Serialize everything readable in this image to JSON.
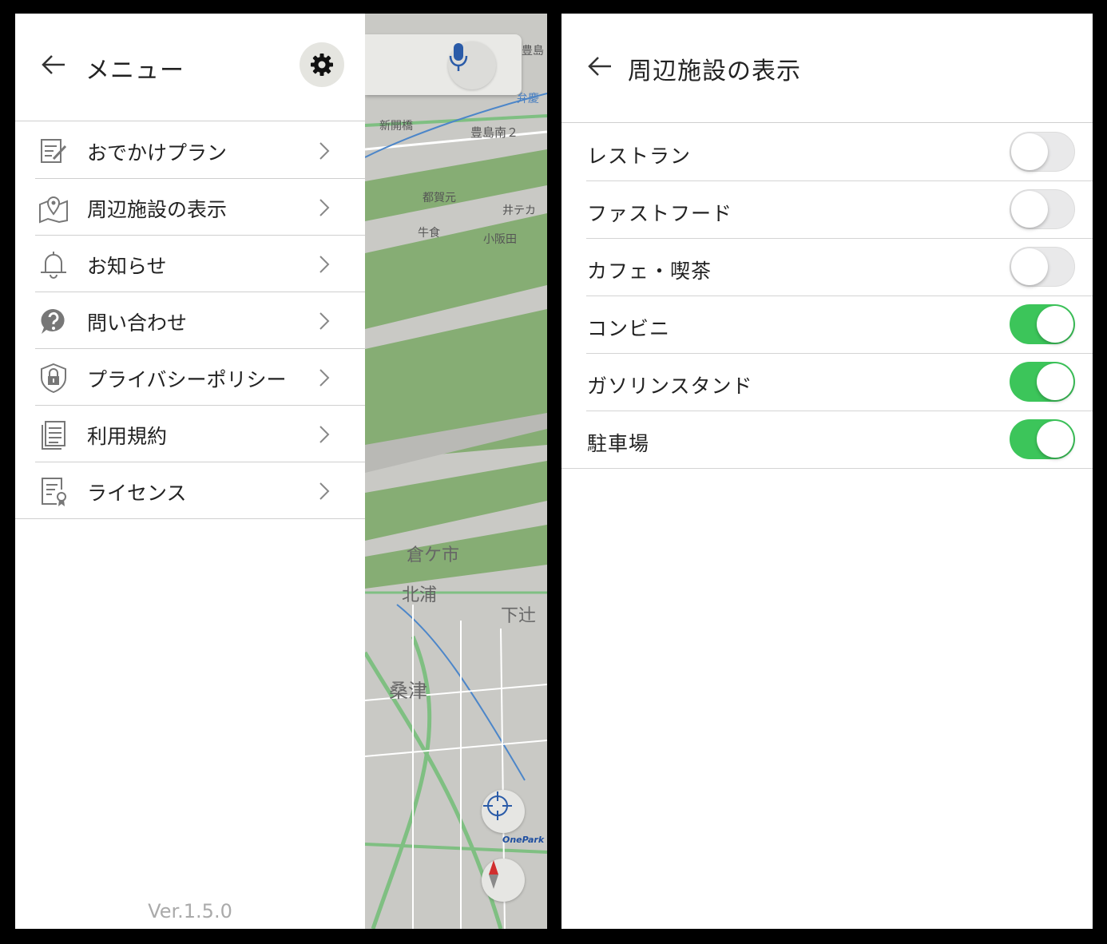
{
  "menu": {
    "title": "メニュー",
    "items": [
      {
        "label": "おでかけプラン"
      },
      {
        "label": "周辺施設の表示"
      },
      {
        "label": "お知らせ"
      },
      {
        "label": "問い合わせ"
      },
      {
        "label": "プライバシーポリシー"
      },
      {
        "label": "利用規約"
      },
      {
        "label": "ライセンス"
      }
    ],
    "version": "Ver.1.5.0"
  },
  "map": {
    "labels": [
      "豊島",
      "弁慶",
      "新開橋",
      "豊島南２",
      "都賀元",
      "井テカ",
      "牛食",
      "小阪田",
      "倉ケ市",
      "北浦",
      "下辻",
      "桑津",
      "OnePark"
    ]
  },
  "facilities": {
    "title": "周辺施設の表示",
    "items": [
      {
        "label": "レストラン",
        "enabled": false
      },
      {
        "label": "ファストフード",
        "enabled": false
      },
      {
        "label": "カフェ・喫茶",
        "enabled": false
      },
      {
        "label": "コンビニ",
        "enabled": true
      },
      {
        "label": "ガソリンスタンド",
        "enabled": true
      },
      {
        "label": "駐車場",
        "enabled": true
      }
    ]
  },
  "colors": {
    "toggle_on": "#3cc55a",
    "toggle_off": "#e9e9ea",
    "map_green": "#86ad74"
  }
}
